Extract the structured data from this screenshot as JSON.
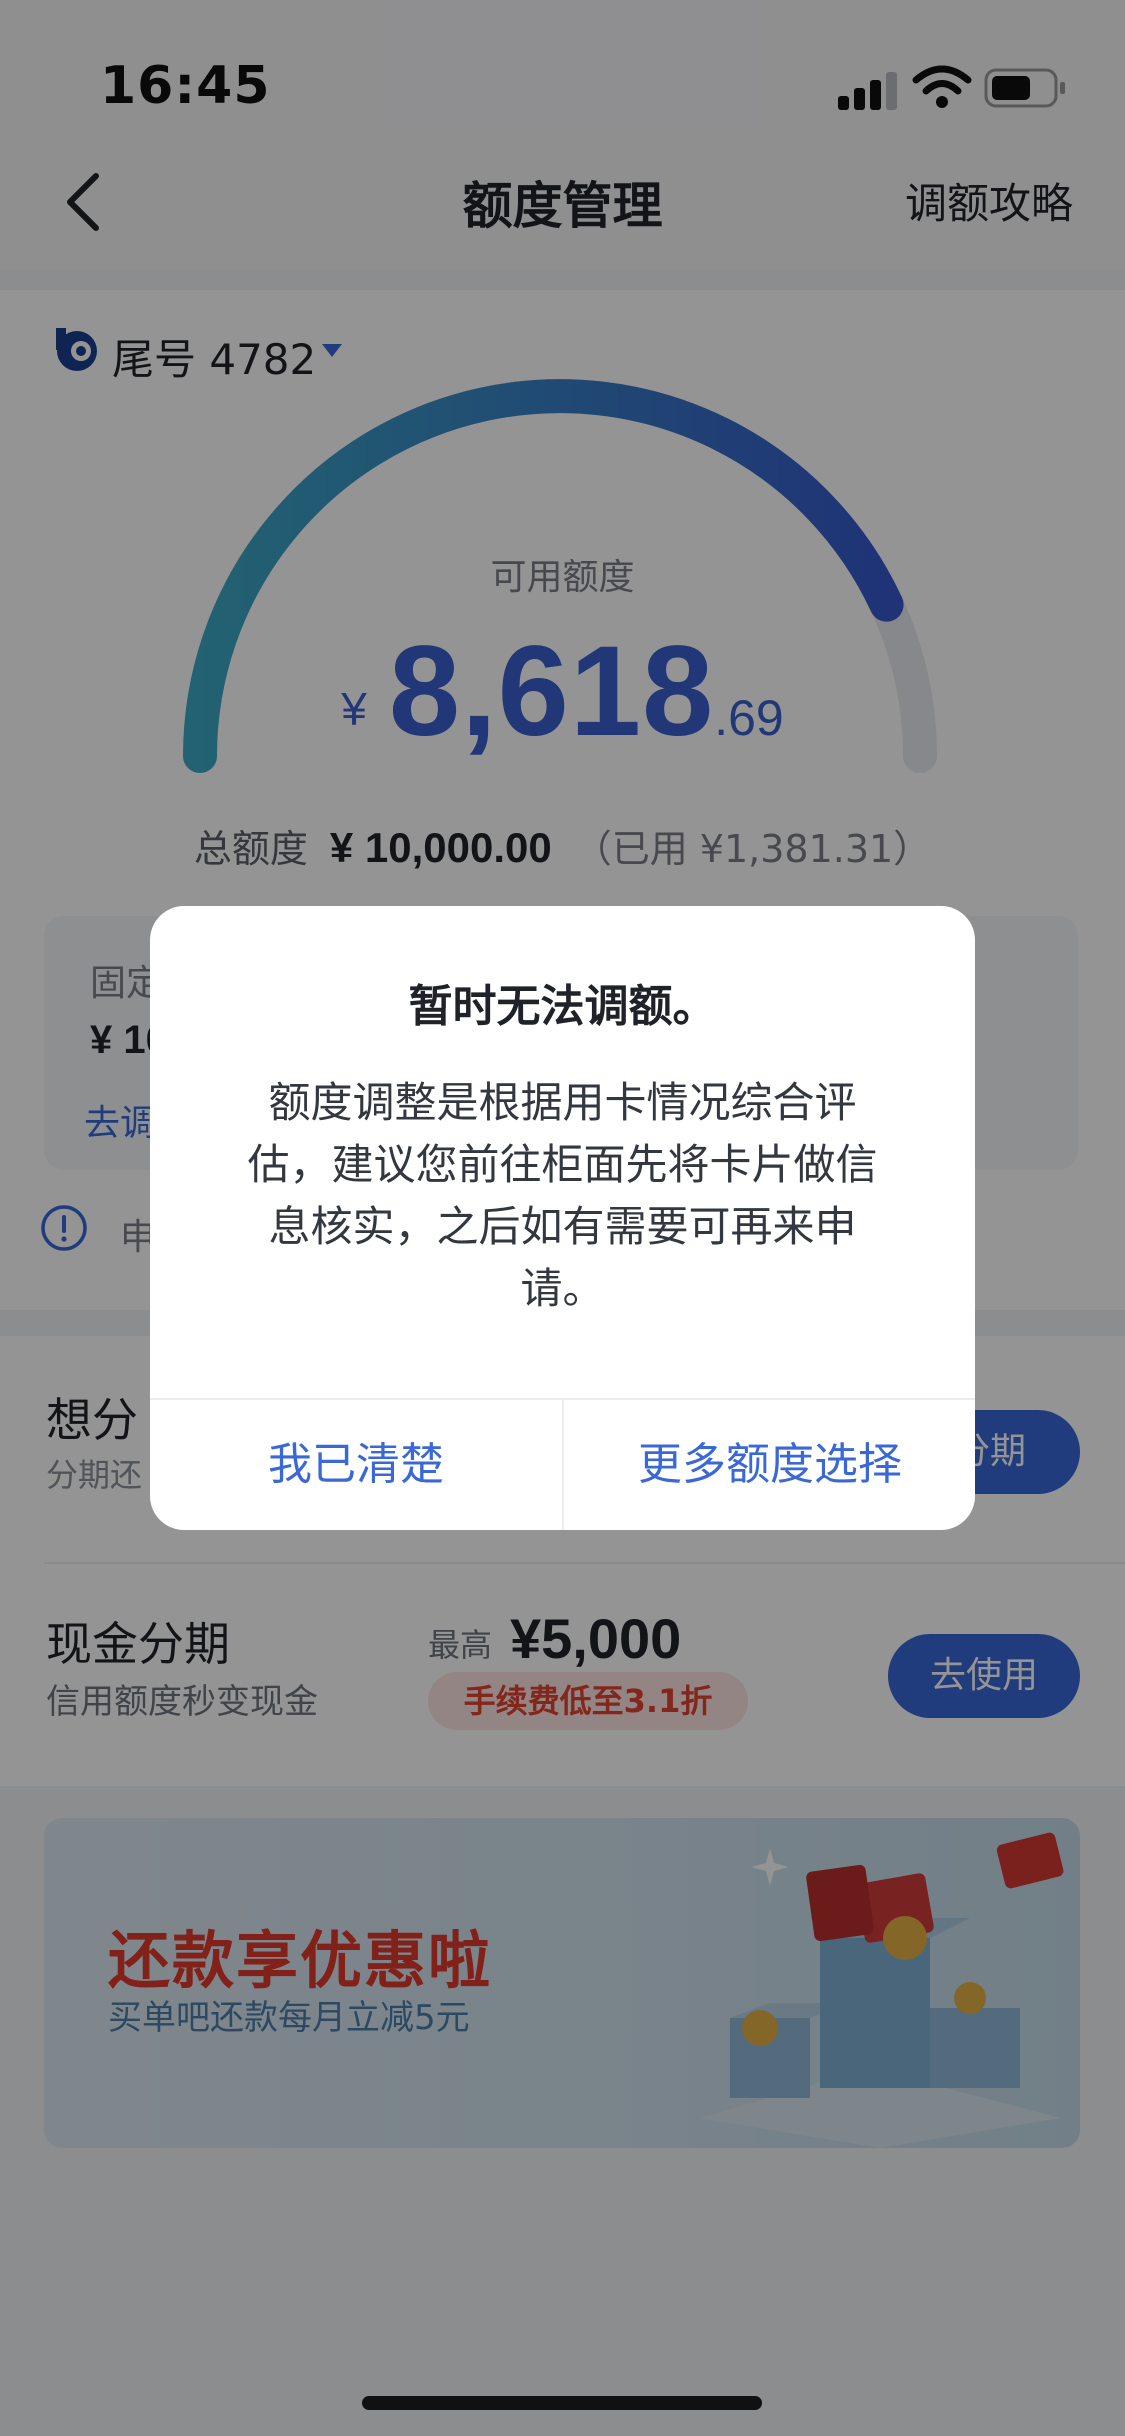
{
  "status_bar": {
    "time": "16:45"
  },
  "nav": {
    "title": "额度管理",
    "action": "调额攻略"
  },
  "card": {
    "tail_label": "尾号 4782"
  },
  "gauge": {
    "available_label": "可用额度",
    "currency": "¥",
    "amount_int": "8,618",
    "amount_dec": ".69",
    "available_fraction": 0.8619
  },
  "totals": {
    "label": "总额度",
    "value": "¥ 10,000.00",
    "used": "（已用 ¥1,381.31）"
  },
  "fixed_limit": {
    "label": "固定",
    "value": "¥ 10",
    "link": "去调"
  },
  "notice": {
    "text": "申"
  },
  "installments": [
    {
      "title": "想分",
      "subtitle": "分期还",
      "button": "分期"
    },
    {
      "title": "现金分期",
      "subtitle": "信用额度秒变现金",
      "max_label": "最高",
      "max_value": "¥5,000",
      "badge": "手续费低至3.1折",
      "button": "去使用"
    }
  ],
  "banner": {
    "title": "还款享优惠啦",
    "subtitle": "买单吧还款每月立减5元"
  },
  "dialog": {
    "title": "暂时无法调额。",
    "body": "额度调整是根据用卡情况综合评估，建议您前往柜面先将卡片做信息核实，之后如有需要可再来申请。",
    "confirm": "我已清楚",
    "more": "更多额度选择"
  },
  "colors": {
    "primary": "#3a68d6",
    "amount": "#3a5fcd",
    "gauge_start": "#3ba9c4",
    "gauge_end": "#3659cc",
    "gauge_track": "#e8eaef",
    "badge_text": "#e2422f",
    "banner_title": "#e03a2b"
  }
}
